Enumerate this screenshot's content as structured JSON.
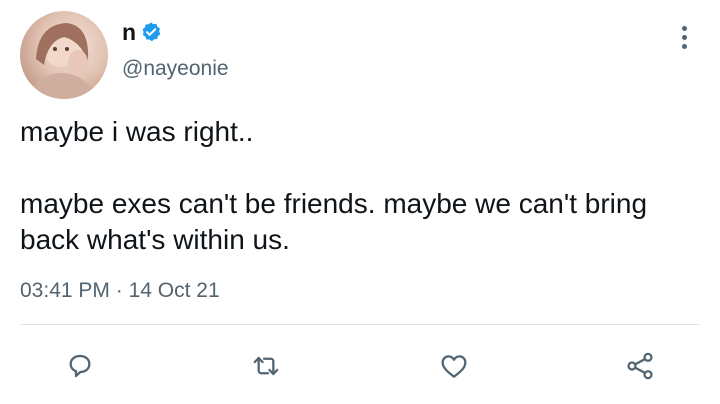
{
  "author": {
    "name": "n",
    "handle": "@nayeonie",
    "verified": true,
    "avatar_icon": "profile-photo"
  },
  "tweet": {
    "text": "maybe i was right..\n\nmaybe exes can't be friends. maybe we can't bring back what's within us.",
    "time": "03:41 PM",
    "separator": "·",
    "date": "14 Oct 21"
  },
  "actions": {
    "reply_icon": "speech-bubble-icon",
    "retweet_icon": "retweet-arrows-icon",
    "like_icon": "heart-icon",
    "share_icon": "share-nodes-icon"
  },
  "colors": {
    "text": "#0f1419",
    "secondary": "#536471",
    "verified_blue": "#1d9bf0",
    "divider": "#dfe3e6"
  }
}
